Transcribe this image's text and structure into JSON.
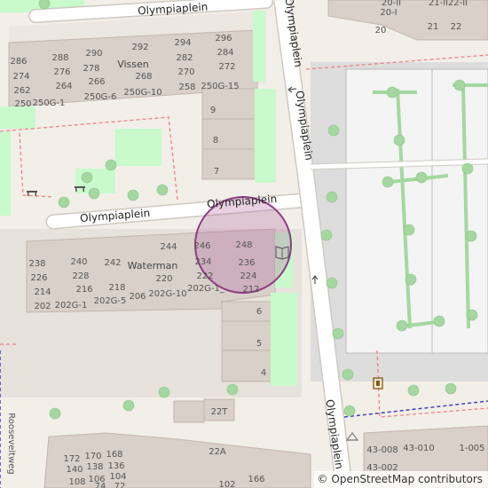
{
  "streets": {
    "top": "Olympiaplein",
    "middle_left": "Olympiaplein",
    "middle_right": "Olympiaplein",
    "vertical_upper": "Olympiaplein",
    "vertical_lower": "Olympiaplein",
    "roosevelt": "Rooseveltweg"
  },
  "buildings": {
    "vissen": "Vissen",
    "waterman": "Waterman"
  },
  "house_numbers": {
    "vissen": [
      "286",
      "288",
      "290",
      "292",
      "294",
      "296",
      "274",
      "276",
      "278",
      "268",
      "282",
      "284",
      "262",
      "264",
      "266",
      "270",
      "272",
      "250",
      "250G-1",
      "250G-6",
      "250G-10",
      "258",
      "250G-15",
      "9",
      "8",
      "7"
    ],
    "waterman": [
      "244",
      "246",
      "248",
      "238",
      "240",
      "242",
      "220",
      "234",
      "236",
      "226",
      "228",
      "216",
      "218",
      "222",
      "224",
      "214",
      "206",
      "202G-10",
      "202G-1",
      "212",
      "202",
      "202G-5",
      "202G-1_",
      "6",
      "5",
      "4",
      "22T"
    ],
    "topright": [
      "20-II",
      "21-II",
      "22-II",
      "20-I",
      "20",
      "21",
      "22"
    ],
    "bottom": [
      "172",
      "170",
      "168",
      "140",
      "138",
      "136",
      "108",
      "106",
      "104",
      "74",
      "72",
      "22A",
      "102",
      "166"
    ],
    "bottom_right": [
      "43-008",
      "43-010",
      "1-005",
      "43-002"
    ]
  },
  "attribution": {
    "copyright": "©",
    "link_text": "OpenStreetMap contributors"
  },
  "colors": {
    "background": "#f2efe9",
    "building": "#d9d0c9",
    "building_edge": "#c4b6ab",
    "road": "#ffffff",
    "road_edge": "#d0cbc5",
    "park": "#c8facc",
    "pitch": "#aae0cb",
    "tree": "#a4d8a0",
    "boundary": "#f08080",
    "admin_boundary": "#3f3fc8",
    "highlight_fill": "#b366a1",
    "highlight_stroke": "#8e3c82"
  },
  "icons": [
    "book-icon",
    "bench-icon",
    "recycling-icon",
    "toilet-icon",
    "one-way-arrow-icon"
  ]
}
